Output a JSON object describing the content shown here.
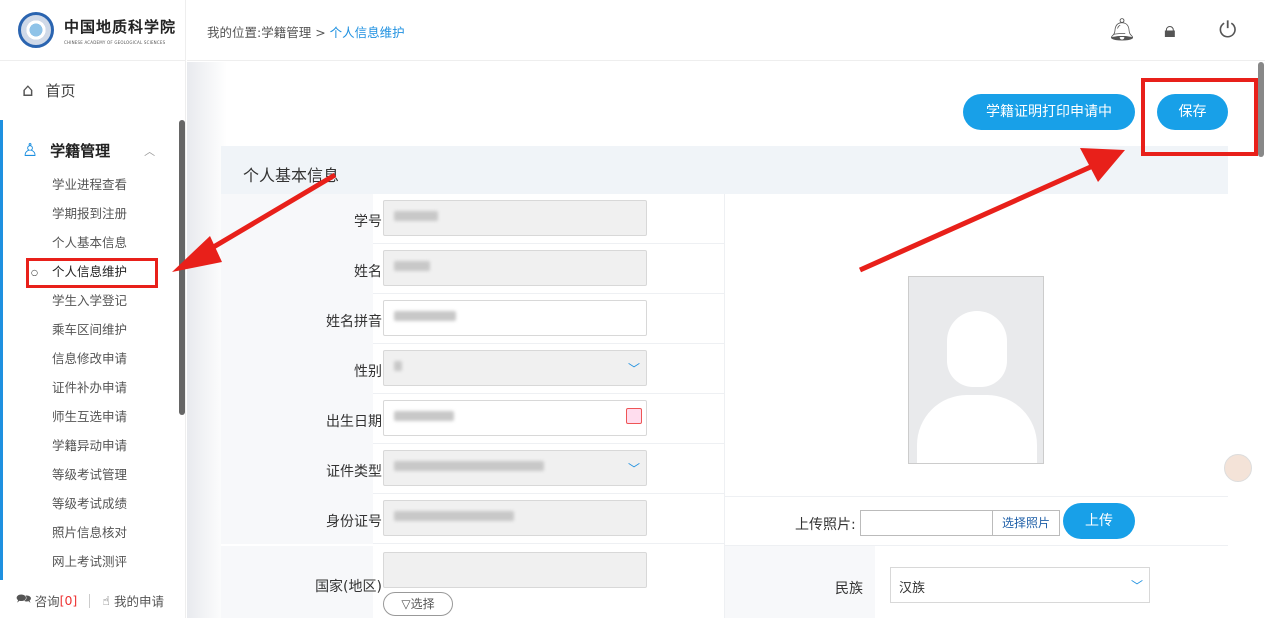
{
  "logo": {
    "cn": "中国地质科学院",
    "en": "CHINESE ACADEMY OF GEOLOGICAL SCIENCES"
  },
  "nav": {
    "home": "首页",
    "group": "学籍管理",
    "items": [
      "学业进程查看",
      "学期报到注册",
      "个人基本信息",
      "个人信息维护",
      "学生入学登记",
      "乘车区间维护",
      "信息修改申请",
      "证件补办申请",
      "师生互选申请",
      "学籍异动申请",
      "等级考试管理",
      "等级考试成绩",
      "照片信息核对",
      "网上考试测评"
    ],
    "active_index": 3
  },
  "bottom": {
    "consult": "咨询",
    "consult_count": "[0]",
    "my_apply": "我的申请"
  },
  "breadcrumb": {
    "prefix": "我的位置:",
    "path": "学籍管理 > ",
    "current": "个人信息维护"
  },
  "actions": {
    "print_cert": "学籍证明打印申请中",
    "save": "保存"
  },
  "panel": {
    "title": "个人基本信息",
    "fields": [
      {
        "label": "学号"
      },
      {
        "label": "姓名"
      },
      {
        "label": "姓名拼音"
      },
      {
        "label": "性别"
      },
      {
        "label": "出生日期"
      },
      {
        "label": "证件类型"
      },
      {
        "label": "身份证号"
      }
    ],
    "country_label": "国家(地区)",
    "country_pick": "▽选择",
    "upload_label": "上传照片:",
    "upload_pick": "选择照片",
    "upload_button": "上传",
    "nation_label": "民族",
    "nation_value": "汉族"
  },
  "colors": {
    "accent": "#18a0e8",
    "annotation": "#e8201a"
  }
}
